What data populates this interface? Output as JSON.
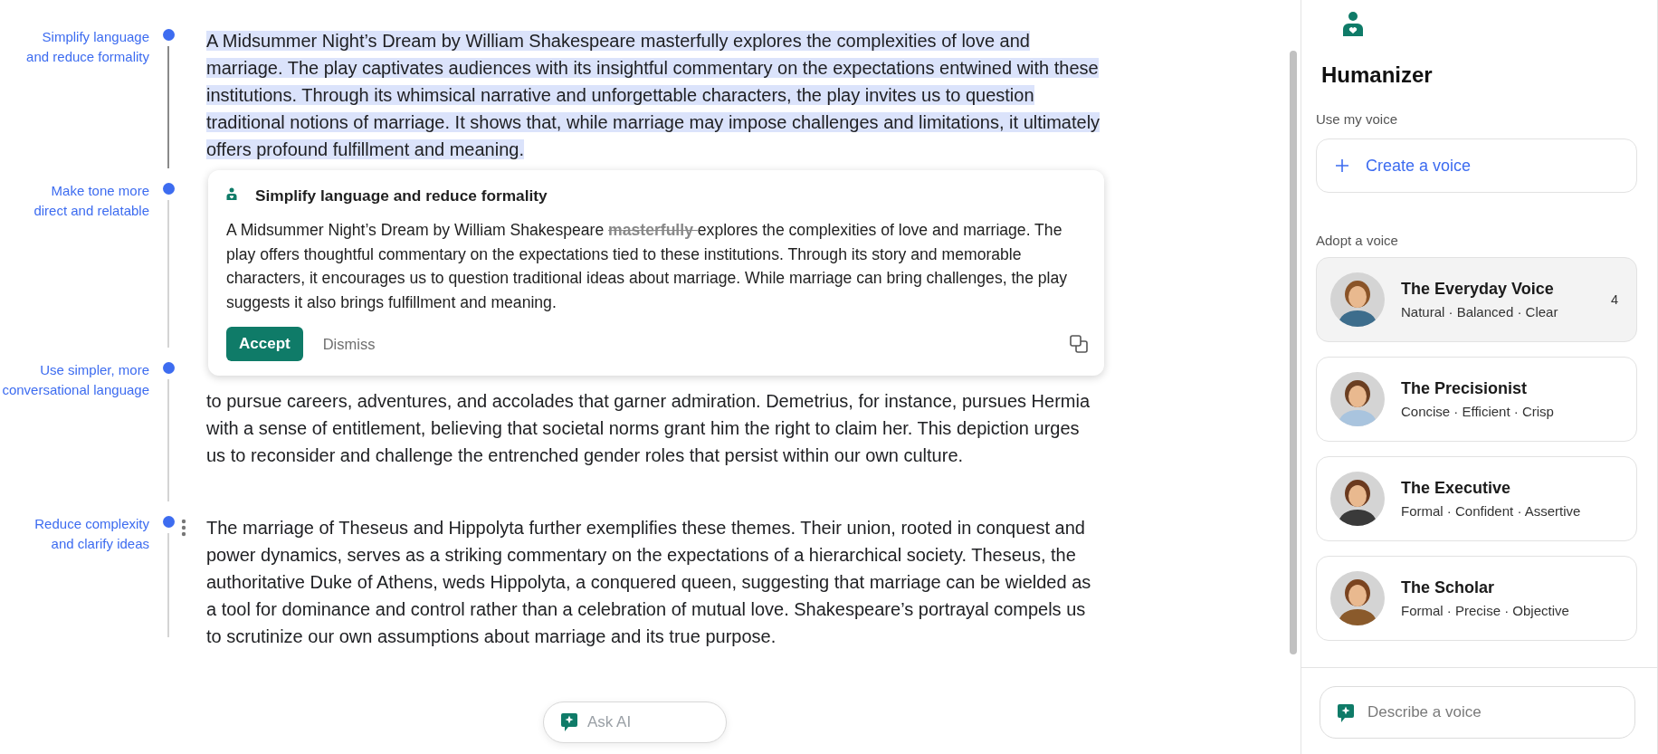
{
  "sections": [
    {
      "label": "Simplify language and reduce formality",
      "selected": true,
      "menu": false,
      "paragraph": {
        "text": "A Midsummer Night’s Dream by William Shakespeare masterfully explores the complexities of love and marriage. The play captivates audiences with its insightful commentary on the expectations entwined with these institutions. Through its whimsical narrative and unforgettable characters, the play invites us to question traditional notions of marriage. It shows that, while marriage may impose challenges and limitations, it ultimately offers profound fulfillment and meaning.",
        "highlighted": true
      }
    },
    {
      "label": "Make tone more direct and relatable",
      "selected": false,
      "menu": false
    },
    {
      "label": "Use simpler, more conversational language",
      "selected": false,
      "menu": false,
      "paragraph": {
        "text": "to pursue careers, adventures, and accolades that garner admiration. Demetrius, for instance, pursues Hermia with a sense of entitlement, believing that societal norms grant him the right to claim her. This depiction urges us to reconsider and challenge the entrenched gender roles that persist within our own culture.",
        "highlighted": false
      }
    },
    {
      "label": "Reduce complexity and clarify ideas",
      "selected": false,
      "menu": true,
      "paragraph": {
        "text": "The marriage of Theseus and Hippolyta further exemplifies these themes. Their union, rooted in conquest and power dynamics, serves as a striking commentary on the expectations of a hierarchical society. Theseus, the authoritative Duke of Athens, weds Hippolyta, a conquered queen, suggesting that marriage can be wielded as a tool for dominance and control rather than a celebration of mutual love. Shakespeare’s portrayal compels us to scrutinize our own assumptions about marriage and its true purpose.",
        "highlighted": false
      }
    }
  ],
  "suggestion_card": {
    "title": "Simplify language and reduce formality",
    "text_before": "A Midsummer Night’s Dream by William Shakespeare ",
    "text_removed": "masterfully ",
    "text_after": "explores the complexities of love and marriage. The play offers thoughtful commentary on the expectations tied to these institutions. Through its story and memorable characters, it encourages us to question traditional ideas about marriage. While marriage can bring challenges, the play suggests it also brings fulfillment and meaning.",
    "accept": "Accept",
    "dismiss": "Dismiss"
  },
  "ask_ai": {
    "placeholder": "Ask AI"
  },
  "panel": {
    "title": "Humanizer",
    "my_voice_label": "Use my voice",
    "create_button": "Create a voice",
    "adopt_label": "Adopt a voice",
    "voices": [
      {
        "name": "The Everyday Voice",
        "traits": "Natural · Balanced · Clear",
        "selected": true,
        "count": "4"
      },
      {
        "name": "The Precisionist",
        "traits": "Concise · Efficient · Crisp",
        "selected": false
      },
      {
        "name": "The Executive",
        "traits": "Formal · Confident · Assertive",
        "selected": false
      },
      {
        "name": "The Scholar",
        "traits": "Formal · Precise · Objective",
        "selected": false
      }
    ],
    "describe": {
      "placeholder": "Describe a voice"
    }
  }
}
